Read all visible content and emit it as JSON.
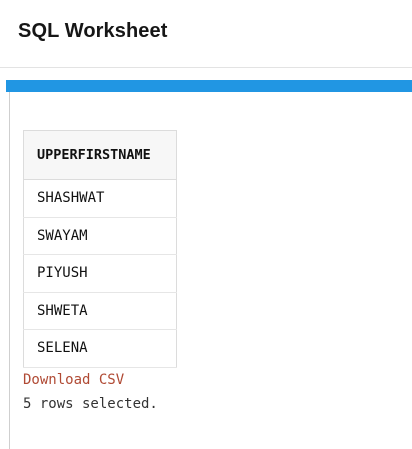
{
  "header": {
    "title": "SQL Worksheet"
  },
  "colors": {
    "accent_bar": "#2196e3",
    "link": "#b04a34"
  },
  "results": {
    "columns": [
      "UPPERFIRSTNAME"
    ],
    "rows": [
      [
        "SHASHWAT"
      ],
      [
        "SWAYAM"
      ],
      [
        "PIYUSH"
      ],
      [
        "SHWETA"
      ],
      [
        "SELENA"
      ]
    ]
  },
  "download_label": "Download CSV",
  "status": "5 rows selected."
}
